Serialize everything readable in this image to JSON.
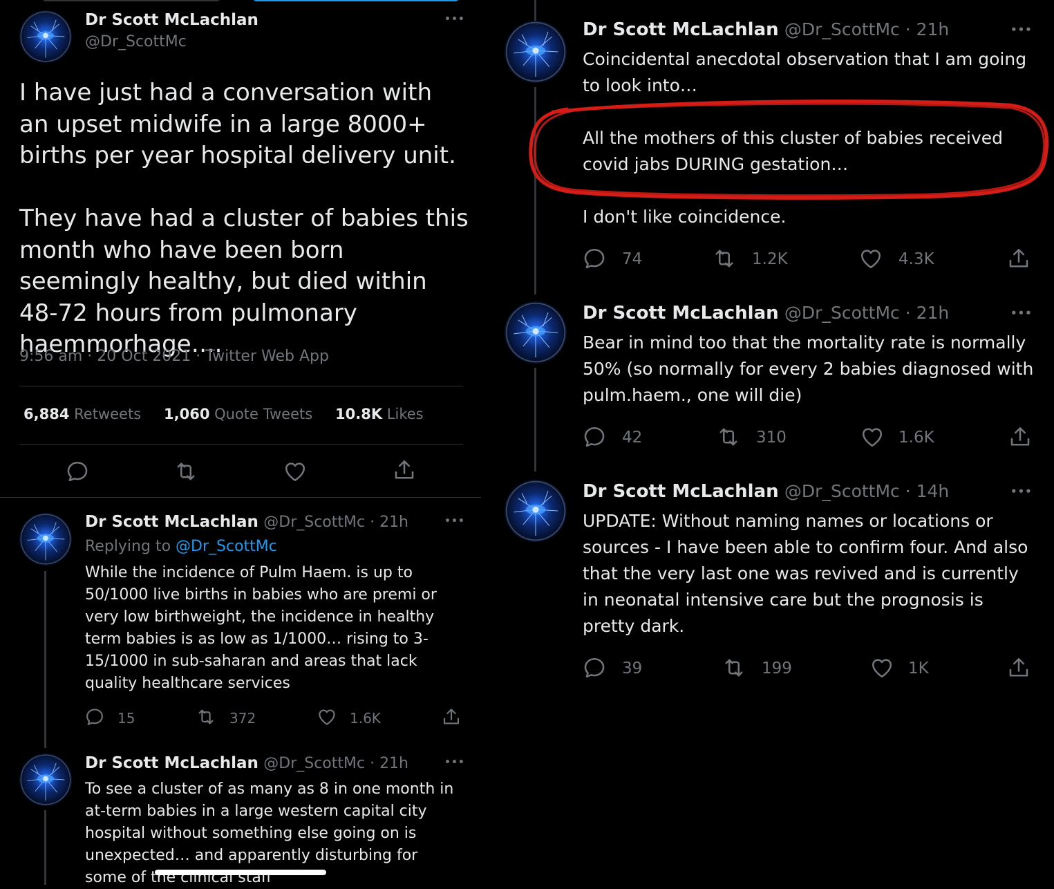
{
  "main_tweet": {
    "name": "Dr Scott McLachlan",
    "handle": "@Dr_ScottMc",
    "text_p1": "I have just had a conversation with an upset midwife in a large 8000+ births per year hospital delivery unit.",
    "text_p2": "They have had a cluster of babies this month who have been born seemingly healthy, but died within 48-72 hours from pulmonary haemmorhage….",
    "timestamp": "9:56 am · 20 Oct 2021 · Twitter Web App",
    "stats": {
      "retweets_count": "6,884",
      "retweets_label": "Retweets",
      "quotes_count": "1,060",
      "quotes_label": "Quote Tweets",
      "likes_count": "10.8K",
      "likes_label": "Likes"
    }
  },
  "left_replies": [
    {
      "name": "Dr Scott McLachlan",
      "meta": "@Dr_ScottMc · 21h",
      "replying_prefix": "Replying to",
      "replying_handle": "@Dr_ScottMc",
      "text": "While the incidence of Pulm Haem. is up to 50/1000 live births in babies who are premi or very low birthweight, the incidence in healthy term babies is as low as 1/1000… rising to 3-15/1000 in sub-saharan and areas that lack quality healthcare services",
      "reply_count": "15",
      "retweet_count": "372",
      "like_count": "1.6K"
    },
    {
      "name": "Dr Scott McLachlan",
      "meta": "@Dr_ScottMc · 21h",
      "text": "To see a cluster of as many as 8 in one month in at-term babies in a large western capital city hospital without something else going on is unexpected… and apparently disturbing for some of the clinical staff"
    }
  ],
  "right_tweets": [
    {
      "name": "Dr Scott McLachlan",
      "meta": "@Dr_ScottMc · 21h",
      "text_p1": "Coincidental anecdotal observation that I am going to look into…",
      "text_p2": "All the mothers of this cluster of babies received covid jabs DURING gestation…",
      "text_p3": "I don't like coincidence.",
      "reply_count": "74",
      "retweet_count": "1.2K",
      "like_count": "4.3K"
    },
    {
      "name": "Dr Scott McLachlan",
      "meta": "@Dr_ScottMc · 21h",
      "text": "Bear in mind too that the mortality rate is normally 50% (so normally for every 2 babies diagnosed with pulm.haem., one will die)",
      "reply_count": "42",
      "retweet_count": "310",
      "like_count": "1.6K"
    },
    {
      "name": "Dr Scott McLachlan",
      "meta": "@Dr_ScottMc · 14h",
      "text": "UPDATE: Without naming names or locations or sources - I have been able to confirm four. And also that the very last one was revived and is currently in neonatal intensive care but the prognosis is pretty dark.",
      "reply_count": "39",
      "retweet_count": "199",
      "like_count": "1K"
    }
  ],
  "more_label": "•••",
  "colors": {
    "background": "#000000",
    "text": "#e7e9ea",
    "muted": "#71767b",
    "link": "#1d9bf0",
    "annotation": "#d61c16"
  }
}
